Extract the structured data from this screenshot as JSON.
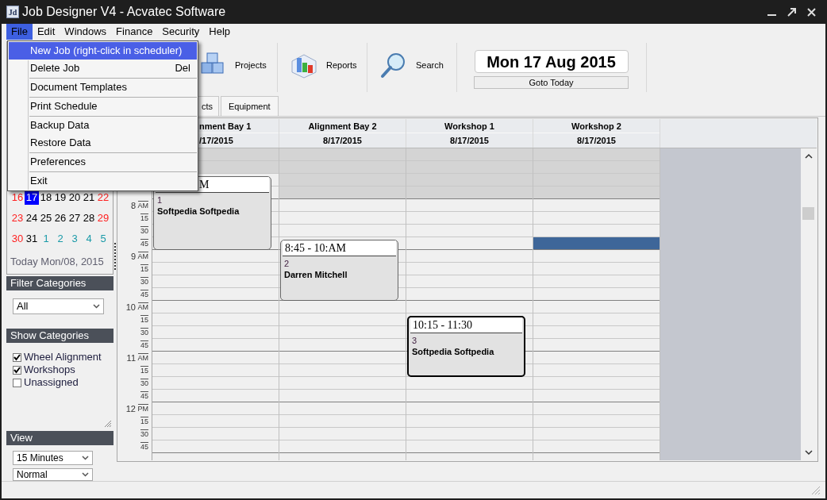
{
  "window": {
    "app_icon": "Jd",
    "title": "Job Designer V4 - Acvatec Software"
  },
  "menubar": [
    {
      "label": "File",
      "selected": true
    },
    {
      "label": "Edit",
      "selected": false
    },
    {
      "label": "Windows",
      "selected": false
    },
    {
      "label": "Finance",
      "selected": false
    },
    {
      "label": "Security",
      "selected": false
    },
    {
      "label": "Help",
      "selected": false
    }
  ],
  "file_menu": {
    "groups": [
      [
        {
          "label": "New Job (right-click in scheduler)",
          "selected": true
        },
        {
          "label": "Delete Job",
          "shortcut": "Del",
          "selected": false
        }
      ],
      [
        {
          "label": "Document Templates",
          "selected": false
        }
      ],
      [
        {
          "label": "Print Schedule",
          "selected": false
        }
      ],
      [
        {
          "label": "Backup Data",
          "selected": false
        },
        {
          "label": "Restore Data",
          "selected": false
        }
      ],
      [
        {
          "label": "Preferences",
          "selected": false
        }
      ],
      [
        {
          "label": "Exit",
          "selected": false
        }
      ]
    ]
  },
  "calendar": {
    "weeks": [
      [
        {
          "day": "16",
          "kind": "weekend",
          "selected": false
        },
        {
          "day": "17",
          "kind": "weekday",
          "selected": true
        },
        {
          "day": "18",
          "kind": "weekday",
          "selected": false
        },
        {
          "day": "19",
          "kind": "weekday",
          "selected": false
        },
        {
          "day": "20",
          "kind": "weekday",
          "selected": false
        },
        {
          "day": "21",
          "kind": "weekday",
          "selected": false
        },
        {
          "day": "22",
          "kind": "weekend",
          "selected": false
        }
      ],
      [
        {
          "day": "23",
          "kind": "weekend",
          "selected": false
        },
        {
          "day": "24",
          "kind": "weekday",
          "selected": false
        },
        {
          "day": "25",
          "kind": "weekday",
          "selected": false
        },
        {
          "day": "26",
          "kind": "weekday",
          "selected": false
        },
        {
          "day": "27",
          "kind": "weekday",
          "selected": false
        },
        {
          "day": "28",
          "kind": "weekday",
          "selected": false
        },
        {
          "day": "29",
          "kind": "weekend",
          "selected": false
        }
      ],
      [
        {
          "day": "30",
          "kind": "weekend",
          "selected": false
        },
        {
          "day": "31",
          "kind": "weekday",
          "selected": false
        },
        {
          "day": "1",
          "kind": "next_month",
          "selected": false
        },
        {
          "day": "2",
          "kind": "next_month",
          "selected": false
        },
        {
          "day": "3",
          "kind": "next_month",
          "selected": false
        },
        {
          "day": "4",
          "kind": "next_month",
          "selected": false
        },
        {
          "day": "5",
          "kind": "next_month",
          "selected": false
        }
      ]
    ],
    "today": "Today Mon/08, 2015"
  },
  "filter_categories": {
    "title": "Filter Categories",
    "value": "All"
  },
  "show_categories": {
    "title": "Show Categories",
    "items": [
      {
        "label": "Wheel Alignment",
        "checked": true
      },
      {
        "label": "Workshops",
        "checked": true
      },
      {
        "label": "Unassigned",
        "checked": false
      }
    ]
  },
  "view": {
    "title": "View",
    "selects": [
      "15 Minutes",
      "Normal"
    ]
  },
  "toolbar": [
    {
      "label": "Projects",
      "kind": "projects"
    },
    {
      "label": "Reports",
      "kind": "reports"
    },
    {
      "label": "Search",
      "kind": "search"
    }
  ],
  "date_display": "Mon 17 Aug 2015",
  "goto_today": "Goto Today",
  "tabs": [
    {
      "label": "cts",
      "cut": true
    },
    {
      "label": "Equipment",
      "cut": false
    }
  ],
  "schedule": {
    "time_slots": [
      {
        "kind": "blank",
        "working": false
      },
      {
        "kind": "blank",
        "working": false
      },
      {
        "kind": "blank",
        "working": false
      },
      {
        "kind": "blank",
        "working": false
      },
      {
        "kind": "hour",
        "label": "8",
        "period": "AM",
        "working": true
      },
      {
        "kind": "minute",
        "label": "15",
        "working": true
      },
      {
        "kind": "minute",
        "label": "30",
        "working": true
      },
      {
        "kind": "minute",
        "label": "45",
        "working": true
      },
      {
        "kind": "hour",
        "label": "9",
        "period": "AM",
        "working": true
      },
      {
        "kind": "minute",
        "label": "15",
        "working": true
      },
      {
        "kind": "minute",
        "label": "30",
        "working": true
      },
      {
        "kind": "minute",
        "label": "45",
        "working": true
      },
      {
        "kind": "hour",
        "label": "10",
        "period": "AM",
        "working": true
      },
      {
        "kind": "minute",
        "label": "15",
        "working": true
      },
      {
        "kind": "minute",
        "label": "30",
        "working": true
      },
      {
        "kind": "minute",
        "label": "45",
        "working": true
      },
      {
        "kind": "hour",
        "label": "11",
        "period": "AM",
        "working": true
      },
      {
        "kind": "minute",
        "label": "15",
        "working": true
      },
      {
        "kind": "minute",
        "label": "30",
        "working": true
      },
      {
        "kind": "minute",
        "label": "45",
        "working": true
      },
      {
        "kind": "hour",
        "label": "12",
        "period": "PM",
        "working": true
      },
      {
        "kind": "minute",
        "label": "15",
        "working": true
      },
      {
        "kind": "minute",
        "label": "30",
        "working": true
      },
      {
        "kind": "minute",
        "label": "45",
        "working": true
      }
    ],
    "columns": [
      {
        "name": "nment Bay 1",
        "date": "/17/2015",
        "cut": true,
        "cells": [
          {
            "kind": "free"
          },
          {
            "kind": "free"
          },
          {
            "kind": "job",
            "time": "M",
            "time_cut": true,
            "number": "1",
            "name": "Softpedia Softpedia",
            "job_selected": false
          },
          {
            "kind": "busy"
          },
          {
            "kind": "busy"
          },
          {
            "kind": "busy"
          },
          {
            "kind": "busy"
          },
          {
            "kind": "busy"
          },
          {
            "kind": "free"
          },
          {
            "kind": "free"
          },
          {
            "kind": "free"
          },
          {
            "kind": "free"
          },
          {
            "kind": "free"
          },
          {
            "kind": "free"
          },
          {
            "kind": "free"
          },
          {
            "kind": "free"
          },
          {
            "kind": "free"
          },
          {
            "kind": "free"
          },
          {
            "kind": "free"
          },
          {
            "kind": "free"
          },
          {
            "kind": "free"
          },
          {
            "kind": "free"
          },
          {
            "kind": "free"
          },
          {
            "kind": "free"
          }
        ]
      },
      {
        "name": "Alignment Bay 2",
        "date": "8/17/2015",
        "cut": false,
        "cells": [
          {
            "kind": "free"
          },
          {
            "kind": "free"
          },
          {
            "kind": "free"
          },
          {
            "kind": "free"
          },
          {
            "kind": "free"
          },
          {
            "kind": "free"
          },
          {
            "kind": "free"
          },
          {
            "kind": "job",
            "time": "8:45 - 10:AM",
            "time_cut": false,
            "number": "2",
            "name": "Darren Mitchell",
            "job_selected": false
          },
          {
            "kind": "busy"
          },
          {
            "kind": "busy"
          },
          {
            "kind": "busy"
          },
          {
            "kind": "busy"
          },
          {
            "kind": "free"
          },
          {
            "kind": "free"
          },
          {
            "kind": "free"
          },
          {
            "kind": "free"
          },
          {
            "kind": "free"
          },
          {
            "kind": "free"
          },
          {
            "kind": "free"
          },
          {
            "kind": "free"
          },
          {
            "kind": "free"
          },
          {
            "kind": "free"
          },
          {
            "kind": "free"
          },
          {
            "kind": "free"
          }
        ]
      },
      {
        "name": "Workshop 1",
        "date": "8/17/2015",
        "cut": false,
        "cells": [
          {
            "kind": "free"
          },
          {
            "kind": "free"
          },
          {
            "kind": "free"
          },
          {
            "kind": "free"
          },
          {
            "kind": "free"
          },
          {
            "kind": "free"
          },
          {
            "kind": "free"
          },
          {
            "kind": "free"
          },
          {
            "kind": "free"
          },
          {
            "kind": "free"
          },
          {
            "kind": "free"
          },
          {
            "kind": "free"
          },
          {
            "kind": "free"
          },
          {
            "kind": "job",
            "time": "10:15 - 11:30",
            "time_cut": false,
            "number": "3",
            "name": "Softpedia Softpedia",
            "job_selected": true
          },
          {
            "kind": "busy"
          },
          {
            "kind": "busy"
          },
          {
            "kind": "busy"
          },
          {
            "kind": "busy"
          },
          {
            "kind": "free"
          },
          {
            "kind": "free"
          },
          {
            "kind": "free"
          },
          {
            "kind": "free"
          },
          {
            "kind": "free"
          },
          {
            "kind": "free"
          }
        ]
      },
      {
        "name": "Workshop 2",
        "date": "8/17/2015",
        "cut": false,
        "cells": [
          {
            "kind": "free"
          },
          {
            "kind": "free"
          },
          {
            "kind": "free"
          },
          {
            "kind": "free"
          },
          {
            "kind": "free"
          },
          {
            "kind": "free"
          },
          {
            "kind": "free"
          },
          {
            "kind": "selected"
          },
          {
            "kind": "free"
          },
          {
            "kind": "free"
          },
          {
            "kind": "free"
          },
          {
            "kind": "free"
          },
          {
            "kind": "free"
          },
          {
            "kind": "free"
          },
          {
            "kind": "free"
          },
          {
            "kind": "free"
          },
          {
            "kind": "free"
          },
          {
            "kind": "free"
          },
          {
            "kind": "free"
          },
          {
            "kind": "free"
          },
          {
            "kind": "free"
          },
          {
            "kind": "free"
          },
          {
            "kind": "free"
          },
          {
            "kind": "free"
          }
        ]
      }
    ]
  }
}
